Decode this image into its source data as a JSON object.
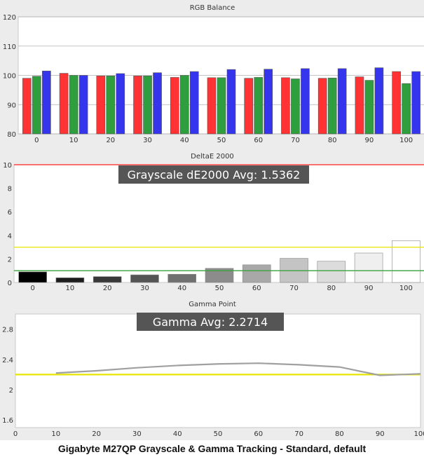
{
  "caption": "Gigabyte M27QP Grayscale & Gamma Tracking - Standard, default",
  "colors": {
    "bg": "#ececec",
    "plot_bg": "#ffffff",
    "grid": "#b0b0b0",
    "axis_text": "#333333",
    "red": "#ff3333",
    "green": "#2e9e3e",
    "blue": "#3535ee",
    "threshold_red": "#ff2020",
    "threshold_yellow": "#e6e600",
    "threshold_green": "#3aa33a",
    "gamma_line": "#a0a0a0",
    "gamma_target": "#e6e600",
    "label_box": "#555555",
    "label_text": "#ffffff"
  },
  "chart_data": [
    {
      "type": "bar",
      "title": "RGB Balance",
      "categories": [
        "0",
        "10",
        "20",
        "30",
        "40",
        "50",
        "60",
        "70",
        "80",
        "90",
        "100"
      ],
      "ylim": [
        80,
        120
      ],
      "yticks": [
        80,
        90,
        100,
        110,
        120
      ],
      "grid": true,
      "series": [
        {
          "color": "red",
          "values": [
            99,
            100.7,
            99.8,
            99.8,
            99.3,
            99.2,
            99,
            99.2,
            99,
            99.5,
            101.3
          ]
        },
        {
          "color": "green",
          "values": [
            99.7,
            100,
            99.8,
            99.8,
            100,
            99.2,
            99.3,
            98.8,
            99.1,
            98.3,
            97.2
          ]
        },
        {
          "color": "blue",
          "values": [
            101.5,
            100,
            100.6,
            100.9,
            101.3,
            102,
            102.1,
            102.3,
            102.3,
            102.6,
            101.3
          ]
        }
      ]
    },
    {
      "type": "bar",
      "title": "DeltaE 2000",
      "annotation": "Grayscale dE2000 Avg: 1.5362",
      "categories": [
        "0",
        "10",
        "20",
        "30",
        "40",
        "50",
        "60",
        "70",
        "80",
        "90",
        "100"
      ],
      "ylim": [
        0,
        10
      ],
      "yticks": [
        0,
        2,
        4,
        6,
        8,
        10
      ],
      "values": [
        0.9,
        0.4,
        0.5,
        0.65,
        0.7,
        1.2,
        1.5,
        2.05,
        1.8,
        2.5,
        3.55
      ],
      "bar_colors": [
        "#000000",
        "#1c1c1c",
        "#383838",
        "#545454",
        "#707070",
        "#8c8c8c",
        "#a8a8a8",
        "#c4c4c4",
        "#dcdcdc",
        "#efefef",
        "#ffffff"
      ],
      "thresholds": [
        {
          "value": 10,
          "color": "threshold_red"
        },
        {
          "value": 3,
          "color": "threshold_yellow"
        },
        {
          "value": 1,
          "color": "threshold_green"
        }
      ]
    },
    {
      "type": "line",
      "title": "Gamma Point",
      "annotation": "Gamma Avg: 2.2714",
      "x": [
        10,
        20,
        30,
        40,
        50,
        60,
        70,
        80,
        90,
        100
      ],
      "y": [
        2.22,
        2.25,
        2.29,
        2.32,
        2.34,
        2.35,
        2.33,
        2.3,
        2.19,
        2.21
      ],
      "target": 2.2,
      "xlim": [
        0,
        100
      ],
      "xticks": [
        0,
        10,
        20,
        30,
        40,
        50,
        60,
        70,
        80,
        90,
        100
      ],
      "ylim": [
        1.5,
        3.0
      ],
      "yticks": [
        1.6,
        2.0,
        2.4,
        2.8
      ],
      "grid": false
    }
  ]
}
